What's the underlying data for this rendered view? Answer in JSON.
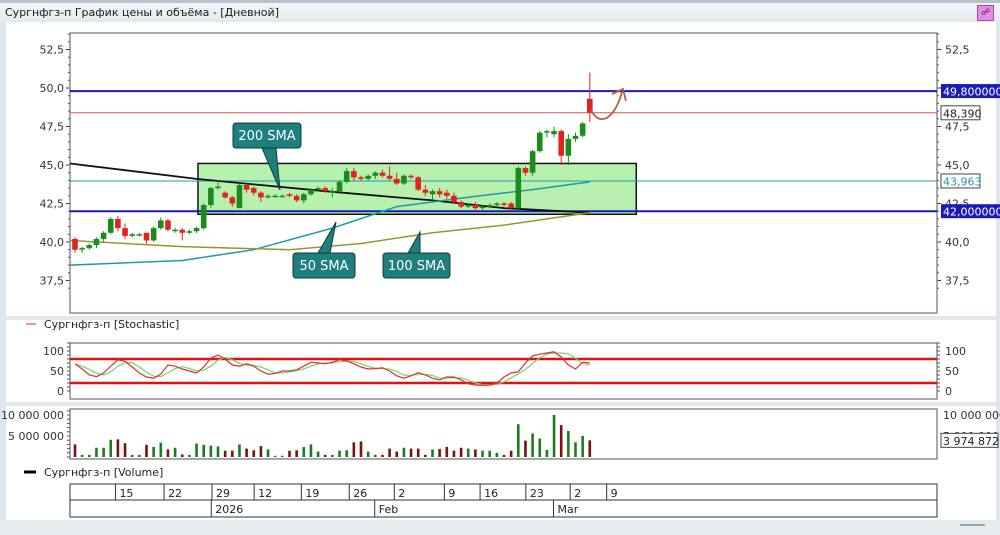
{
  "window": {
    "title": "Сургнфгз-п График цены и объёма - [Дневной]",
    "pin_icon": "link-icon"
  },
  "colors": {
    "bull": "#1b8c1b",
    "bear": "#e2231a",
    "vol_bull": "#1e7a1e",
    "vol_bear": "#7a1212",
    "level_blue": "#1a1ab8",
    "last_price": "#e05050",
    "sma50": "#1f9aaa",
    "sma100": "#9a9430",
    "sma200": "#111111",
    "zone_fill": "#b8f0b0",
    "callout": "#1f7f7f",
    "stoch_k": "#e03030",
    "stoch_d": "#66dd66",
    "arrow": "#b0603a"
  },
  "chart_data": [
    {
      "type": "candlestick",
      "panel": "price",
      "y_ticks": [
        "52,5",
        "50,0",
        "47,5",
        "45,0",
        "42,5",
        "40,0",
        "37,5"
      ],
      "ylim": [
        36.5,
        53.6
      ],
      "candles_ohlc": [
        [
          40.2,
          40.3,
          39.3,
          39.5
        ],
        [
          39.6,
          39.7,
          39.3,
          39.6
        ],
        [
          39.6,
          39.9,
          39.5,
          39.8
        ],
        [
          39.8,
          40.3,
          39.6,
          40.2
        ],
        [
          40.2,
          40.7,
          40.0,
          40.6
        ],
        [
          40.6,
          41.6,
          40.5,
          41.5
        ],
        [
          41.5,
          41.7,
          40.7,
          40.9
        ],
        [
          40.9,
          41.2,
          40.2,
          40.4
        ],
        [
          40.4,
          40.6,
          40.3,
          40.5
        ],
        [
          40.5,
          40.6,
          40.4,
          40.5
        ],
        [
          40.6,
          40.6,
          39.9,
          40.1
        ],
        [
          40.1,
          41.0,
          40.0,
          40.9
        ],
        [
          40.9,
          41.6,
          40.8,
          41.4
        ],
        [
          41.4,
          41.5,
          40.7,
          40.8
        ],
        [
          40.8,
          40.9,
          40.6,
          40.8
        ],
        [
          40.8,
          40.9,
          40.1,
          40.6
        ],
        [
          40.6,
          40.8,
          40.5,
          40.7
        ],
        [
          40.7,
          41.0,
          40.6,
          40.9
        ],
        [
          40.9,
          42.5,
          40.8,
          42.4
        ],
        [
          42.4,
          43.6,
          42.2,
          43.5
        ],
        [
          43.5,
          44.0,
          43.4,
          43.6
        ],
        [
          43.2,
          43.3,
          42.8,
          42.9
        ],
        [
          42.9,
          43.0,
          42.3,
          42.5
        ],
        [
          42.2,
          43.8,
          42.2,
          43.7
        ],
        [
          43.7,
          43.8,
          43.2,
          43.4
        ],
        [
          43.5,
          43.6,
          43.0,
          43.2
        ],
        [
          43.2,
          43.3,
          42.6,
          42.9
        ],
        [
          43.0,
          43.1,
          42.8,
          43.0
        ],
        [
          43.0,
          43.1,
          42.9,
          43.0
        ],
        [
          43.0,
          43.1,
          42.9,
          43.0
        ],
        [
          43.1,
          43.2,
          42.9,
          43.0
        ],
        [
          43.0,
          43.1,
          42.6,
          42.7
        ],
        [
          42.7,
          43.2,
          42.5,
          43.1
        ],
        [
          43.1,
          43.5,
          43.0,
          43.4
        ],
        [
          43.4,
          43.6,
          43.3,
          43.5
        ],
        [
          43.5,
          43.6,
          43.2,
          43.3
        ],
        [
          43.3,
          43.5,
          42.9,
          43.3
        ],
        [
          43.3,
          44.0,
          43.2,
          43.9
        ],
        [
          43.9,
          44.8,
          43.8,
          44.6
        ],
        [
          44.6,
          44.8,
          44.0,
          44.2
        ],
        [
          44.2,
          44.3,
          44.0,
          44.1
        ],
        [
          44.1,
          44.4,
          44.0,
          44.3
        ],
        [
          44.3,
          44.6,
          44.1,
          44.5
        ],
        [
          44.5,
          44.7,
          44.2,
          44.3
        ],
        [
          44.3,
          44.9,
          44.0,
          44.1
        ],
        [
          44.1,
          44.5,
          43.7,
          43.8
        ],
        [
          43.8,
          44.4,
          43.7,
          44.3
        ],
        [
          44.3,
          44.4,
          44.1,
          44.2
        ],
        [
          44.2,
          44.3,
          43.3,
          43.4
        ],
        [
          43.4,
          43.7,
          43.0,
          43.2
        ],
        [
          43.1,
          43.4,
          42.7,
          43.3
        ],
        [
          43.3,
          43.5,
          42.9,
          43.1
        ],
        [
          43.2,
          43.4,
          42.8,
          43.0
        ],
        [
          43.0,
          43.2,
          42.5,
          42.6
        ],
        [
          42.6,
          42.7,
          42.2,
          42.3
        ],
        [
          42.3,
          42.5,
          42.2,
          42.4
        ],
        [
          42.4,
          42.6,
          42.1,
          42.2
        ],
        [
          42.2,
          42.4,
          42.1,
          42.3
        ],
        [
          42.3,
          42.5,
          42.2,
          42.4
        ],
        [
          42.4,
          42.6,
          42.3,
          42.5
        ],
        [
          42.5,
          42.6,
          42.3,
          42.4
        ],
        [
          42.5,
          42.6,
          42.1,
          42.2
        ],
        [
          42.2,
          44.9,
          42.1,
          44.8
        ],
        [
          44.8,
          44.9,
          44.3,
          44.5
        ],
        [
          44.5,
          46.0,
          44.3,
          45.9
        ],
        [
          45.9,
          47.2,
          45.8,
          47.1
        ],
        [
          47.2,
          47.3,
          46.8,
          47.2
        ],
        [
          47.0,
          47.5,
          46.8,
          47.2
        ],
        [
          47.2,
          47.3,
          45.0,
          45.6
        ],
        [
          45.6,
          47.0,
          45.0,
          46.7
        ],
        [
          46.7,
          47.1,
          46.5,
          46.9
        ],
        [
          46.9,
          47.8,
          46.8,
          47.7
        ],
        [
          49.3,
          51.0,
          47.8,
          48.4
        ]
      ],
      "sma": [
        {
          "name": "200 SMA",
          "points": [
            [
              -0.7,
              45.1
            ],
            [
              17,
              44.1
            ],
            [
              35,
              43.3
            ],
            [
              50,
              42.7
            ],
            [
              60,
              42.2
            ],
            [
              72,
              41.9
            ]
          ]
        },
        {
          "name": "50 SMA",
          "points": [
            [
              -0.7,
              38.5
            ],
            [
              15,
              38.8
            ],
            [
              25,
              39.5
            ],
            [
              36,
              40.9
            ],
            [
              45,
              42.3
            ],
            [
              55,
              42.9
            ],
            [
              64,
              43.4
            ],
            [
              72,
              43.9
            ]
          ]
        },
        {
          "name": "100 SMA",
          "points": [
            [
              -0.7,
              40.1
            ],
            [
              15,
              39.7
            ],
            [
              30,
              39.5
            ],
            [
              40,
              39.9
            ],
            [
              50,
              40.6
            ],
            [
              60,
              41.1
            ],
            [
              72,
              41.9
            ]
          ]
        }
      ],
      "horizontal_levels": [
        {
          "value": 49.8,
          "label": "49,800000",
          "style": "blue"
        },
        {
          "value": 48.39,
          "label": "48,390",
          "style": "last"
        },
        {
          "value": 43.963,
          "label": "43,963",
          "style": "sma50"
        },
        {
          "value": 42.0,
          "label": "42,000000",
          "style": "blue"
        }
      ],
      "zone": {
        "from_index": 17.2,
        "to_index": 78.5,
        "low": 41.8,
        "high": 45.1
      },
      "callouts": [
        "200 SMA",
        "50 SMA",
        "100 SMA"
      ]
    },
    {
      "type": "line",
      "panel": "stochastic",
      "legend": "Сургнфгз-п [Stochastic]",
      "y_ticks": [
        "100",
        "50",
        "0"
      ],
      "levels": [
        80,
        20
      ],
      "k": [
        68,
        55,
        40,
        36,
        45,
        62,
        78,
        74,
        60,
        45,
        35,
        32,
        42,
        65,
        62,
        55,
        50,
        45,
        60,
        82,
        90,
        80,
        65,
        62,
        68,
        62,
        50,
        42,
        44,
        50,
        50,
        53,
        62,
        72,
        70,
        68,
        72,
        78,
        75,
        68,
        60,
        55,
        56,
        58,
        50,
        38,
        32,
        38,
        46,
        40,
        32,
        28,
        35,
        35,
        28,
        18,
        15,
        14,
        15,
        20,
        35,
        45,
        48,
        70,
        88,
        92,
        95,
        98,
        85,
        65,
        55,
        72,
        70
      ],
      "d": [
        68,
        62,
        54,
        44,
        40,
        48,
        62,
        71,
        71,
        60,
        47,
        37,
        36,
        46,
        56,
        61,
        56,
        50,
        52,
        62,
        77,
        84,
        78,
        69,
        65,
        64,
        60,
        53,
        45,
        45,
        48,
        51,
        55,
        62,
        68,
        70,
        70,
        73,
        75,
        74,
        68,
        61,
        57,
        56,
        55,
        49,
        40,
        39,
        42,
        41,
        39,
        32,
        32,
        33,
        33,
        27,
        20,
        16,
        15,
        16,
        23,
        33,
        43,
        54,
        69,
        83,
        92,
        95,
        95,
        93,
        82,
        68,
        66
      ]
    },
    {
      "type": "bar",
      "panel": "volume",
      "legend": "Сургнфгз-п [Volume]",
      "y_ticks": [
        "10 000 000",
        "5 000 000"
      ],
      "last_value_label": "3 974 872",
      "values_millions": [
        3.0,
        0.5,
        0.5,
        2.2,
        2.2,
        4.1,
        4.2,
        3.3,
        0.5,
        0.5,
        2.9,
        2.4,
        3.4,
        1.8,
        2.2,
        0.6,
        0.5,
        3.2,
        2.9,
        2.7,
        2.5,
        1.5,
        1.5,
        3.0,
        2.0,
        1.6,
        2.6,
        1.8,
        0.3,
        0.3,
        1.5,
        1.6,
        2.4,
        3.0,
        1.3,
        0.5,
        0.5,
        1.5,
        1.6,
        3.5,
        3.7,
        1.3,
        0.5,
        0.5,
        2.0,
        1.3,
        2.2,
        2.0,
        2.0,
        0.5,
        1.8,
        1.9,
        2.4,
        1.5,
        2.2,
        2.0,
        1.8,
        1.5,
        1.5,
        1.0,
        0.5,
        1.5,
        7.8,
        3.9,
        5.6,
        4.4,
        1.7,
        10.0,
        7.6,
        6.2,
        3.5,
        5.0,
        3.97
      ]
    }
  ],
  "date_axis": {
    "days": [
      {
        "label": "15",
        "index": 3
      },
      {
        "label": "22",
        "index": 9.8
      },
      {
        "label": "29",
        "index": 16.5
      },
      {
        "label": "12",
        "index": 22.4
      },
      {
        "label": "19",
        "index": 29
      },
      {
        "label": "26",
        "index": 35.7
      },
      {
        "label": "2",
        "index": 42
      },
      {
        "label": "9",
        "index": 49
      },
      {
        "label": "16",
        "index": 54
      },
      {
        "label": "23",
        "index": 60.4
      },
      {
        "label": "2",
        "index": 66.6
      },
      {
        "label": "9",
        "index": 71.7
      }
    ],
    "months": [
      {
        "label": "2026",
        "index": 18.5
      },
      {
        "label": "Feb",
        "index": 41.5
      },
      {
        "label": "Mar",
        "index": 66.5
      }
    ]
  }
}
